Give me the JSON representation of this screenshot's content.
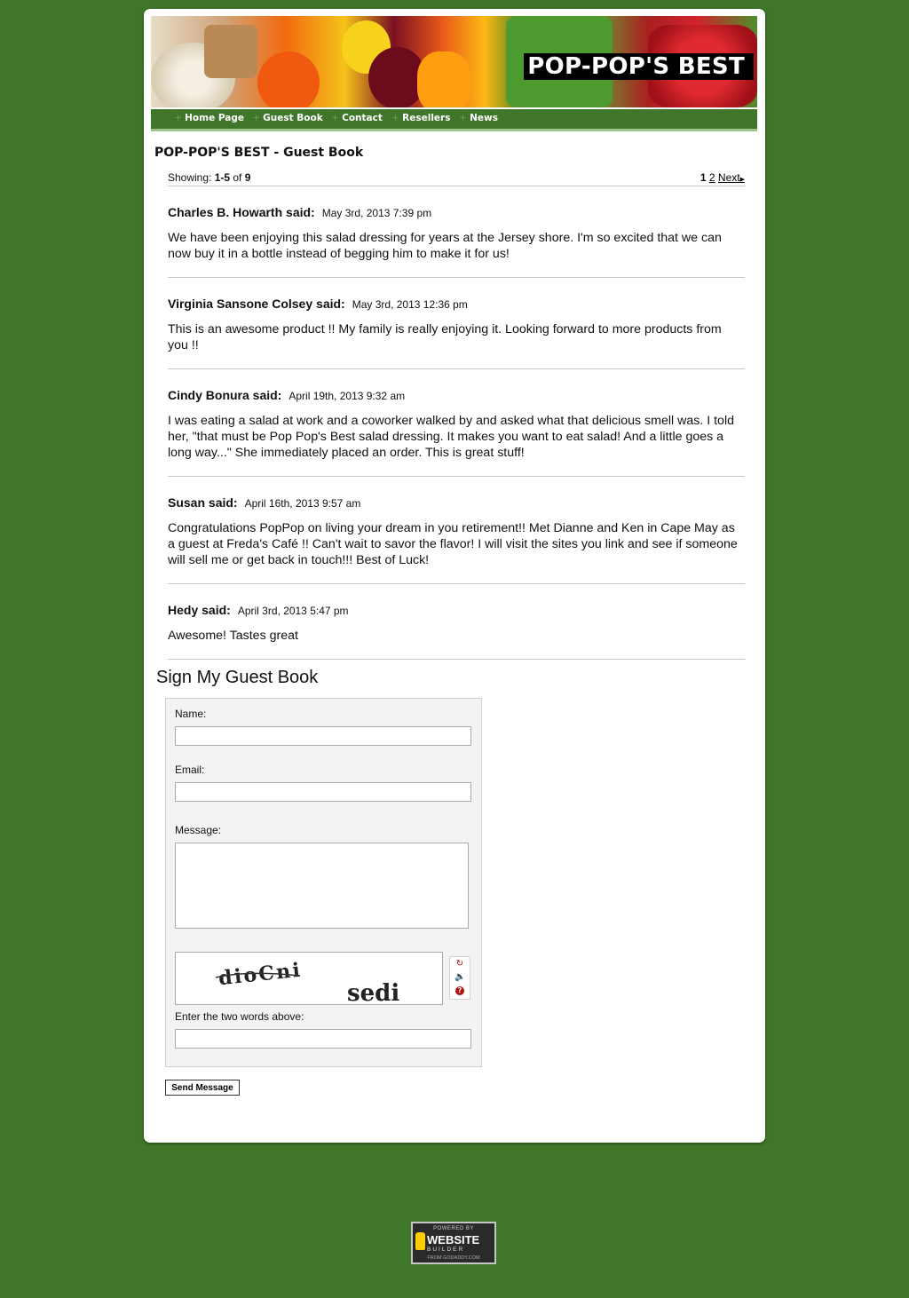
{
  "site": {
    "title": "POP-POP'S BEST"
  },
  "nav": {
    "items": [
      "Home Page",
      "Guest Book",
      "Contact",
      "Resellers",
      "News"
    ]
  },
  "guestbook": {
    "title": "POP-POP'S BEST - Guest Book",
    "showing_label": "Showing: ",
    "showing_range": "1-5",
    "of_label": " of ",
    "total": "9",
    "pages": [
      "1",
      "2"
    ],
    "next_label": "Next",
    "said_suffix": " said:",
    "entries": [
      {
        "author": "Charles B. Howarth",
        "date": "May 3rd, 2013 7:39 pm",
        "message": "We have been enjoying this salad dressing for years at the Jersey shore. I'm so excited that we can now buy it in a bottle instead of begging him to make it for us!"
      },
      {
        "author": "Virginia Sansone Colsey",
        "date": "May 3rd, 2013 12:36 pm",
        "message": "This is an awesome product !! My family is really enjoying it. Looking forward to more products from you !!"
      },
      {
        "author": "Cindy Bonura",
        "date": "April 19th, 2013 9:32 am",
        "message": "I was eating a salad at work and a coworker walked by and asked what that delicious smell was. I told her, \"that must be Pop Pop's Best salad dressing. It makes you want to eat salad! And a little goes a long way...\" She immediately placed an order. This is great stuff!"
      },
      {
        "author": "Susan",
        "date": "April 16th, 2013 9:57 am",
        "message": "Congratulations PopPop on living your dream in you retirement!! Met Dianne and Ken in Cape May as a guest at Freda's Café !! Can't wait to savor the flavor! I will visit the sites you link and see if someone will sell me or get back in touch!!! Best of Luck!"
      },
      {
        "author": "Hedy",
        "date": "April 3rd, 2013 5:47 pm",
        "message": "Awesome! Tastes great"
      }
    ]
  },
  "form": {
    "title": "Sign My Guest Book",
    "name_label": "Name:",
    "name_value": "",
    "email_label": "Email:",
    "email_value": "",
    "message_label": "Message:",
    "message_value": "",
    "captcha_words": [
      "dioCni",
      "sedi"
    ],
    "captcha_label": "Enter the two words above:",
    "captcha_value": "",
    "send_label": "Send Message"
  },
  "badge": {
    "top": "POWERED BY",
    "main": "WEBSITE",
    "sub": "BUILDER",
    "bottom": "FROM GODADDY.COM"
  }
}
